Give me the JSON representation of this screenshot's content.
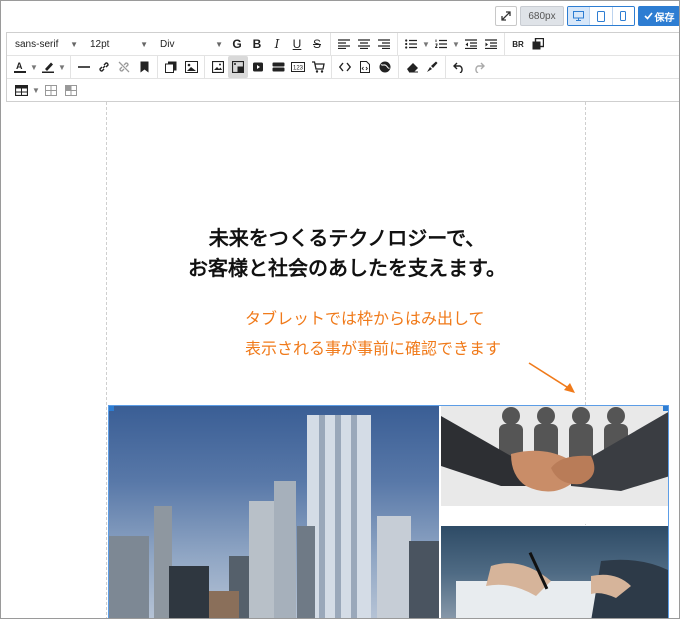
{
  "topbar": {
    "width_badge": "680px",
    "save_label": "保存",
    "devices": [
      "desktop-icon",
      "tablet-icon",
      "mobile-icon"
    ],
    "active_device": "desktop"
  },
  "toolbar": {
    "font_family": "sans-serif",
    "font_size": "12pt",
    "block_format": "Div"
  },
  "content": {
    "headline_line1": "未来をつくるテクノロジーで、",
    "headline_line2": "お客様と社会のあしたを支えます。",
    "note_line1": "タブレットでは枠からはみ出して",
    "note_line2": "表示される事が事前に確認できます"
  },
  "colors": {
    "accent": "#2d7dd2",
    "annotation": "#f07a1a"
  }
}
